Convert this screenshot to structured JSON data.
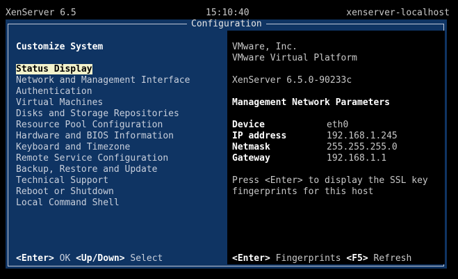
{
  "topbar": {
    "product": "XenServer 6.5",
    "time": "15:10:40",
    "hostname": "xenserver-localhost"
  },
  "window": {
    "title": "Configuration"
  },
  "menu": {
    "heading": "Customize System",
    "items": [
      "Status Display",
      "Network and Management Interface",
      "Authentication",
      "Virtual Machines",
      "Disks and Storage Repositories",
      "Resource Pool Configuration",
      "Hardware and BIOS Information",
      "Keyboard and Timezone",
      "Remote Service Configuration",
      "Backup, Restore and Update",
      "Technical Support",
      "Reboot or Shutdown",
      "Local Command Shell"
    ],
    "selected_index": 0,
    "footer": {
      "key1": "<Enter>",
      "label1": "OK",
      "key2": "<Up/Down>",
      "label2": "Select"
    }
  },
  "details": {
    "vendor": "VMware, Inc.",
    "platform": "VMware Virtual Platform",
    "version": "XenServer 6.5.0-90233c",
    "section_title": "Management Network Parameters",
    "params": [
      {
        "label": "Device",
        "value": "eth0"
      },
      {
        "label": "IP address",
        "value": "192.168.1.245"
      },
      {
        "label": "Netmask",
        "value": "255.255.255.0"
      },
      {
        "label": "Gateway",
        "value": "192.168.1.1"
      }
    ],
    "hint_line1": "Press <Enter> to display the SSL key",
    "hint_line2": "fingerprints for this host",
    "footer": {
      "key1": "<Enter>",
      "label1": "Fingerprints",
      "key2": "<F5>",
      "label2": "Refresh"
    }
  },
  "colors": {
    "panel_blue": "#0f3463",
    "selection_bg": "#f2f2cc",
    "text_white": "#ffffff",
    "text_gray": "#c8c8c8"
  }
}
